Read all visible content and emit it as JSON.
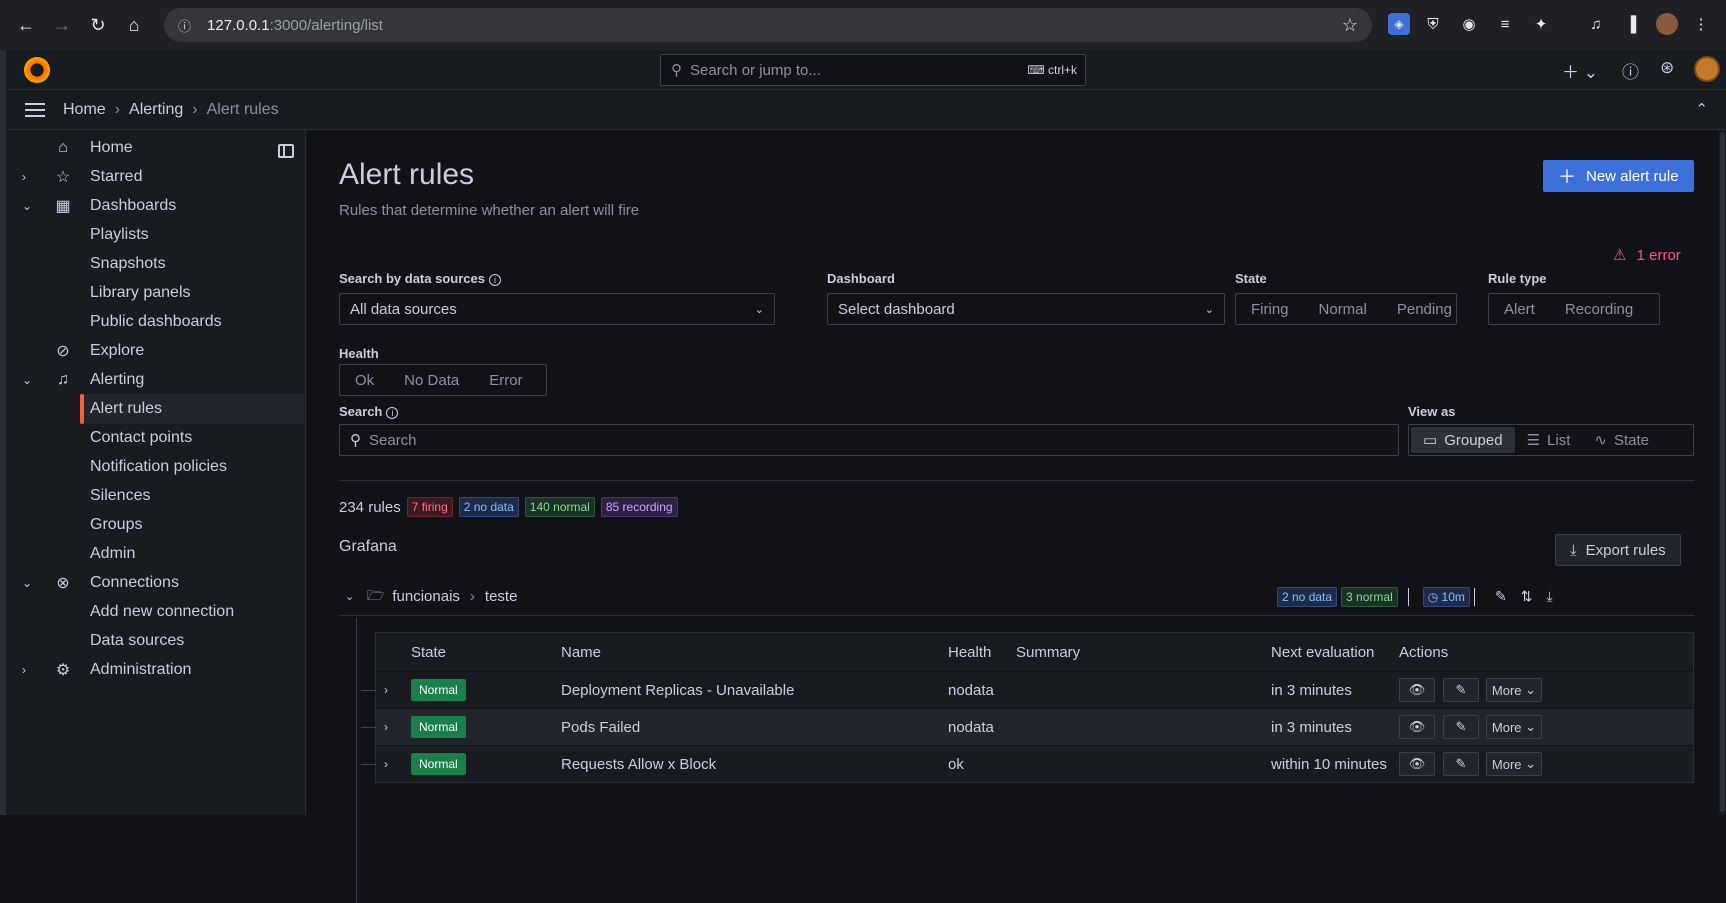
{
  "browser": {
    "url_host": "127.0.0.1",
    "url_path": ":3000/alerting/list"
  },
  "topbar": {
    "search_placeholder": "Search or jump to...",
    "search_shortcut": "ctrl+k"
  },
  "breadcrumb": {
    "items": [
      "Home",
      "Alerting",
      "Alert rules"
    ]
  },
  "sidebar": {
    "items": [
      {
        "label": "Home",
        "icon": "home-icon"
      },
      {
        "label": "Starred",
        "icon": "star-icon"
      },
      {
        "label": "Dashboards",
        "icon": "apps-icon"
      },
      {
        "label": "Playlists"
      },
      {
        "label": "Snapshots"
      },
      {
        "label": "Library panels"
      },
      {
        "label": "Public dashboards"
      },
      {
        "label": "Explore",
        "icon": "compass-icon"
      },
      {
        "label": "Alerting",
        "icon": "bell-icon"
      },
      {
        "label": "Alert rules"
      },
      {
        "label": "Contact points"
      },
      {
        "label": "Notification policies"
      },
      {
        "label": "Silences"
      },
      {
        "label": "Groups"
      },
      {
        "label": "Admin"
      },
      {
        "label": "Connections",
        "icon": "connections-icon"
      },
      {
        "label": "Add new connection"
      },
      {
        "label": "Data sources"
      },
      {
        "label": "Administration",
        "icon": "cog-icon"
      }
    ]
  },
  "page": {
    "title": "Alert rules",
    "subtitle": "Rules that determine whether an alert will fire",
    "new_button": "New alert rule",
    "error_label": "1 error"
  },
  "filters": {
    "datasource_label": "Search by data sources",
    "datasource_value": "All data sources",
    "dashboard_label": "Dashboard",
    "dashboard_placeholder": "Select dashboard",
    "state_label": "State",
    "state_options": [
      "Firing",
      "Normal",
      "Pending"
    ],
    "ruletype_label": "Rule type",
    "ruletype_options": [
      "Alert",
      "Recording"
    ],
    "health_label": "Health",
    "health_options": [
      "Ok",
      "No Data",
      "Error"
    ],
    "search_label": "Search",
    "search_placeholder": "Search",
    "viewas_label": "View as",
    "viewas_options": [
      "Grouped",
      "List",
      "State"
    ],
    "viewas_selected": "Grouped"
  },
  "summary": {
    "total": "234 rules",
    "firing": "7 firing",
    "nodata": "2 no data",
    "normal": "140 normal",
    "recording": "85 recording"
  },
  "section": {
    "title": "Grafana",
    "export_button": "Export rules"
  },
  "group": {
    "folder": "funcionais",
    "name": "teste",
    "nodata_badge": "2 no data",
    "normal_badge": "3 normal",
    "interval": "10m"
  },
  "table": {
    "headers": [
      "State",
      "Name",
      "Health",
      "Summary",
      "Next evaluation",
      "Actions"
    ],
    "rows": [
      {
        "state": "Normal",
        "name": "Deployment Replicas - Unavailable",
        "health": "nodata",
        "summary": "",
        "next": "in 3 minutes"
      },
      {
        "state": "Normal",
        "name": "Pods Failed",
        "health": "nodata",
        "summary": "",
        "next": "in 3 minutes"
      },
      {
        "state": "Normal",
        "name": "Requests Allow x Block",
        "health": "ok",
        "summary": "",
        "next": "within 10 minutes"
      }
    ],
    "more_label": "More"
  },
  "colors": {
    "accent": "#3d71d9",
    "error": "#ff5286",
    "normal_badge": "#1a7f4b",
    "active_marker": "#f55f3e"
  }
}
